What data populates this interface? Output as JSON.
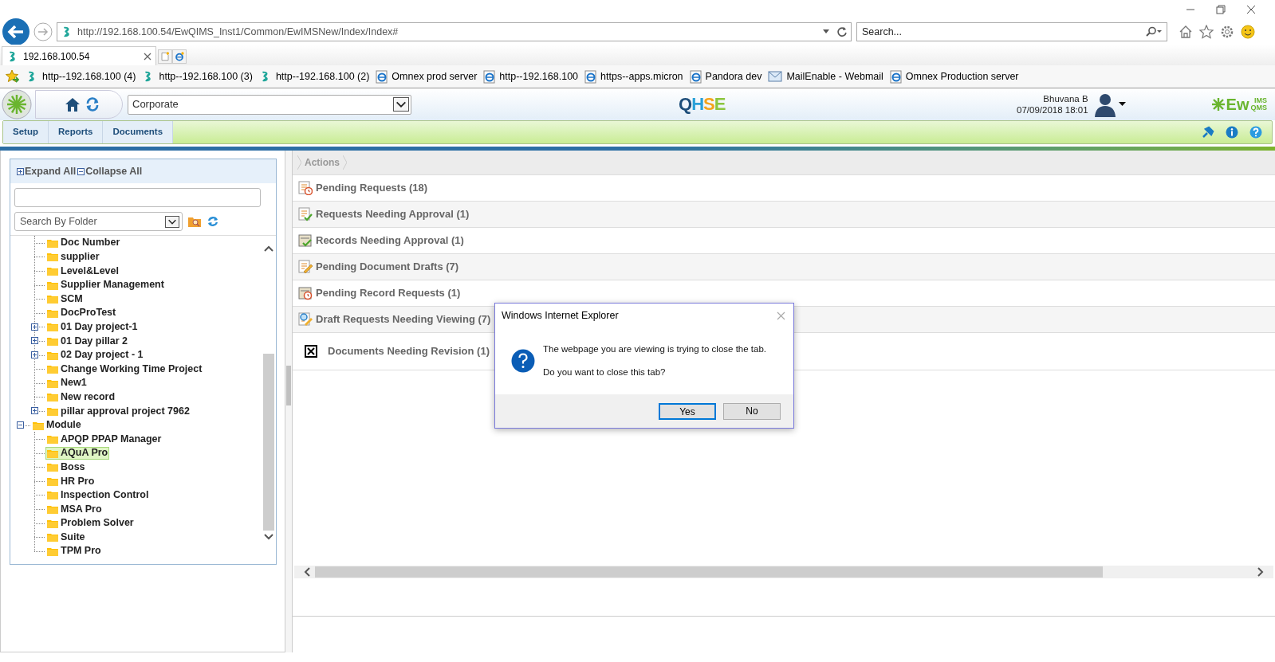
{
  "browser": {
    "address": "http://192.168.100.54/EwQIMS_Inst1/Common/EwIMSNew/Index/Index#",
    "search": {
      "placeholder": "Search..."
    },
    "tabs": [
      {
        "label": "192.168.100.54",
        "selected": true
      }
    ],
    "favorites": [
      {
        "label": "http--192.168.100 (4)",
        "kind": "site"
      },
      {
        "label": "http--192.168.100 (3)",
        "kind": "site"
      },
      {
        "label": "http--192.168.100 (2)",
        "kind": "site"
      },
      {
        "label": "Omnex prod server",
        "kind": "ie"
      },
      {
        "label": "http--192.168.100",
        "kind": "ie"
      },
      {
        "label": "https--apps.micron",
        "kind": "ie"
      },
      {
        "label": "Pandora dev",
        "kind": "ie"
      },
      {
        "label": "MailEnable - Webmail",
        "kind": "mail"
      },
      {
        "label": "Omnex Production server",
        "kind": "ie"
      }
    ]
  },
  "app": {
    "company": "Corporate",
    "logo_text": "QHSE",
    "brand": {
      "main": "Ew",
      "top": "IMS",
      "bottom": "QMS"
    },
    "user": {
      "name": "Bhuvana B",
      "datetime": "07/09/2018 18:01"
    },
    "menu": [
      {
        "label": "Setup"
      },
      {
        "label": "Reports"
      },
      {
        "label": "Documents"
      }
    ]
  },
  "tree_panel": {
    "expand_all": "Expand All",
    "collapse_all": "Collapse All",
    "search_by": "Search By Folder",
    "items": [
      {
        "children": [
          {
            "label": "Doc Number",
            "selected": false
          },
          {
            "label": "supplier",
            "selected": false
          },
          {
            "label": "Level&Level",
            "selected": false
          },
          {
            "label": "Supplier Management",
            "selected": false
          },
          {
            "label": "SCM",
            "selected": false
          },
          {
            "label": "DocProTest",
            "selected": false
          },
          {
            "label": "01 Day project-1",
            "selected": false,
            "expanded": false
          },
          {
            "label": "01 Day pillar 2",
            "selected": false,
            "expanded": false
          },
          {
            "label": "02 Day project - 1",
            "selected": false,
            "expanded": false
          },
          {
            "label": "Change Working Time Project",
            "selected": false
          },
          {
            "label": "New1",
            "selected": false
          },
          {
            "label": "New record",
            "selected": false
          },
          {
            "label": "pillar approval project 7962",
            "selected": false,
            "expanded": false
          }
        ]
      },
      {
        "label": "Module",
        "selected": false,
        "expanded": true,
        "children": [
          {
            "label": "APQP PPAP Manager",
            "selected": false
          },
          {
            "label": "AQuA Pro",
            "selected": true
          },
          {
            "label": "Boss",
            "selected": false
          },
          {
            "label": "HR Pro",
            "selected": false
          },
          {
            "label": "Inspection Control",
            "selected": false
          },
          {
            "label": "MSA Pro",
            "selected": false
          },
          {
            "label": "Problem Solver",
            "selected": false
          },
          {
            "label": "Suite",
            "selected": false
          },
          {
            "label": "TPM Pro",
            "selected": false
          }
        ]
      }
    ]
  },
  "actions": {
    "breadcrumb": "Actions",
    "rows": [
      {
        "label": "Pending Requests (18)",
        "kind": "request"
      },
      {
        "label": "Requests Needing Approval (1)",
        "kind": "approval"
      },
      {
        "label": "Records Needing Approval (1)",
        "kind": "record-approval"
      },
      {
        "label": "Pending Document Drafts (7)",
        "kind": "draft"
      },
      {
        "label": "Pending Record Requests (1)",
        "kind": "record-request"
      },
      {
        "label": "Draft Requests Needing Viewing (7)",
        "kind": "view"
      },
      {
        "label": "Documents Needing Revision (1)",
        "kind": "revision"
      }
    ]
  },
  "dialog": {
    "title": "Windows Internet Explorer",
    "message": "The webpage you are viewing is trying to close the tab.",
    "question": "Do you want to close this tab?",
    "buttons": [
      {
        "label": "Yes",
        "selected": true
      },
      {
        "label": "No",
        "selected": false
      }
    ]
  }
}
